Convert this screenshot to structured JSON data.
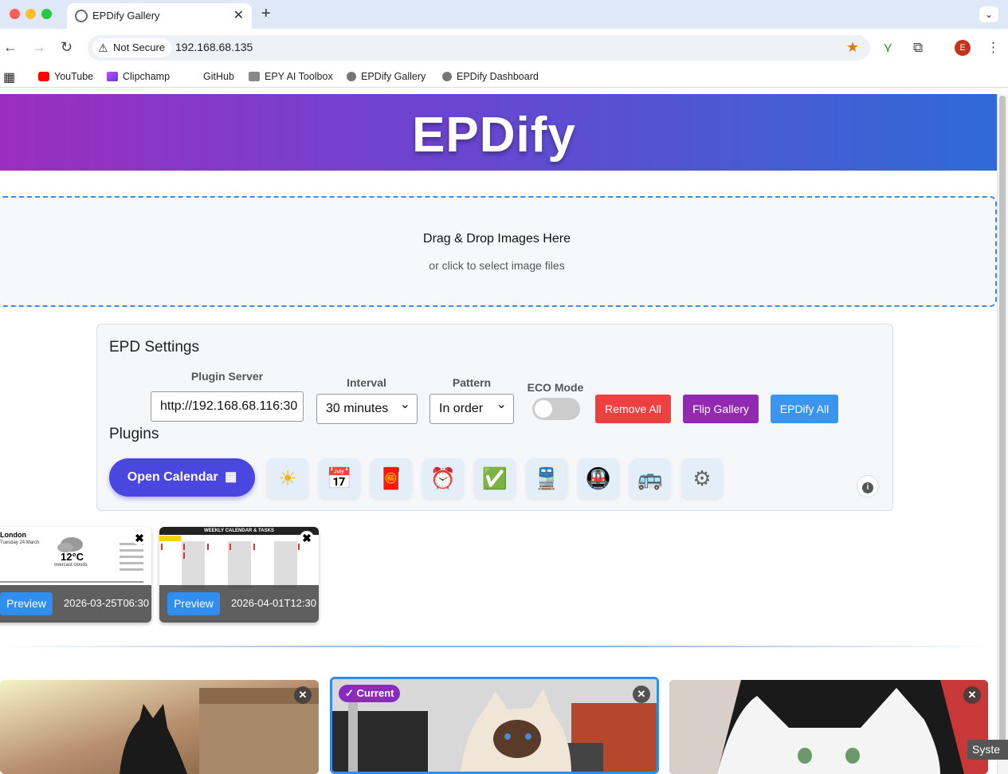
{
  "browser": {
    "tab_title": "EPDify Gallery",
    "tab_close": "✕",
    "new_tab": "+",
    "tab_menu": "⌄",
    "security_label": "Not Secure",
    "url": "192.168.68.135",
    "avatar_letter": "E",
    "bookmarks": [
      {
        "label": "YouTube",
        "color": "#ff0000"
      },
      {
        "label": "Clipchamp",
        "color": "#8a3ffc"
      },
      {
        "label": "GitHub",
        "color": "#ffffff"
      },
      {
        "label": "EPY AI Toolbox",
        "color": "#777777"
      },
      {
        "label": "EPDify Gallery",
        "color": "#666666"
      },
      {
        "label": "EPDify Dashboard",
        "color": "#666666"
      }
    ]
  },
  "hero": {
    "title": "EPDify"
  },
  "dropzone": {
    "title": "Drag & Drop Images Here",
    "subtitle": "or click to select image files"
  },
  "settings": {
    "heading": "EPD Settings",
    "plugin_server_label": "Plugin Server",
    "plugin_server_value": "http://192.168.68.116:30",
    "interval_label": "Interval",
    "interval_value": "30 minutes",
    "pattern_label": "Pattern",
    "pattern_value": "In order",
    "eco_label": "ECO Mode",
    "eco_enabled": false,
    "remove_all": "Remove All",
    "flip_gallery": "Flip Gallery",
    "epdify_all": "EPDify All",
    "colors": {
      "remove": "#ef4040",
      "flip": "#9329b3",
      "epdify": "#3a95ee"
    }
  },
  "plugins": {
    "heading": "Plugins",
    "calendar_button": "Open Calendar",
    "calendar_icon": "▦",
    "icons": [
      {
        "name": "sun-icon",
        "glyph": "☀"
      },
      {
        "name": "calendar-icon",
        "glyph": "📅"
      },
      {
        "name": "red-envelope-icon",
        "glyph": "🧧"
      },
      {
        "name": "alarm-clock-icon",
        "glyph": "⏰"
      },
      {
        "name": "checkmark-icon",
        "glyph": "✅"
      },
      {
        "name": "train-icon",
        "glyph": "🚆"
      },
      {
        "name": "metro-icon",
        "glyph": "🚇"
      },
      {
        "name": "bus-icon",
        "glyph": "🚌"
      },
      {
        "name": "gear-icon",
        "glyph": "⚙"
      }
    ],
    "info": "i"
  },
  "plugin_cards": [
    {
      "kind": "weather",
      "city": "London",
      "date_line": "Tuesday 24 March",
      "temp": "12°C",
      "condition": "overcast clouds",
      "preview": "Preview",
      "timestamp": "2026-03-25T06:30"
    },
    {
      "kind": "calendar",
      "header": "WEEKLY CALENDAR & TASKS",
      "preview": "Preview",
      "timestamp": "2026-04-01T12:30"
    }
  ],
  "gallery": {
    "current_badge": "✓ Current",
    "close": "✕",
    "system_tip": "Syste"
  }
}
